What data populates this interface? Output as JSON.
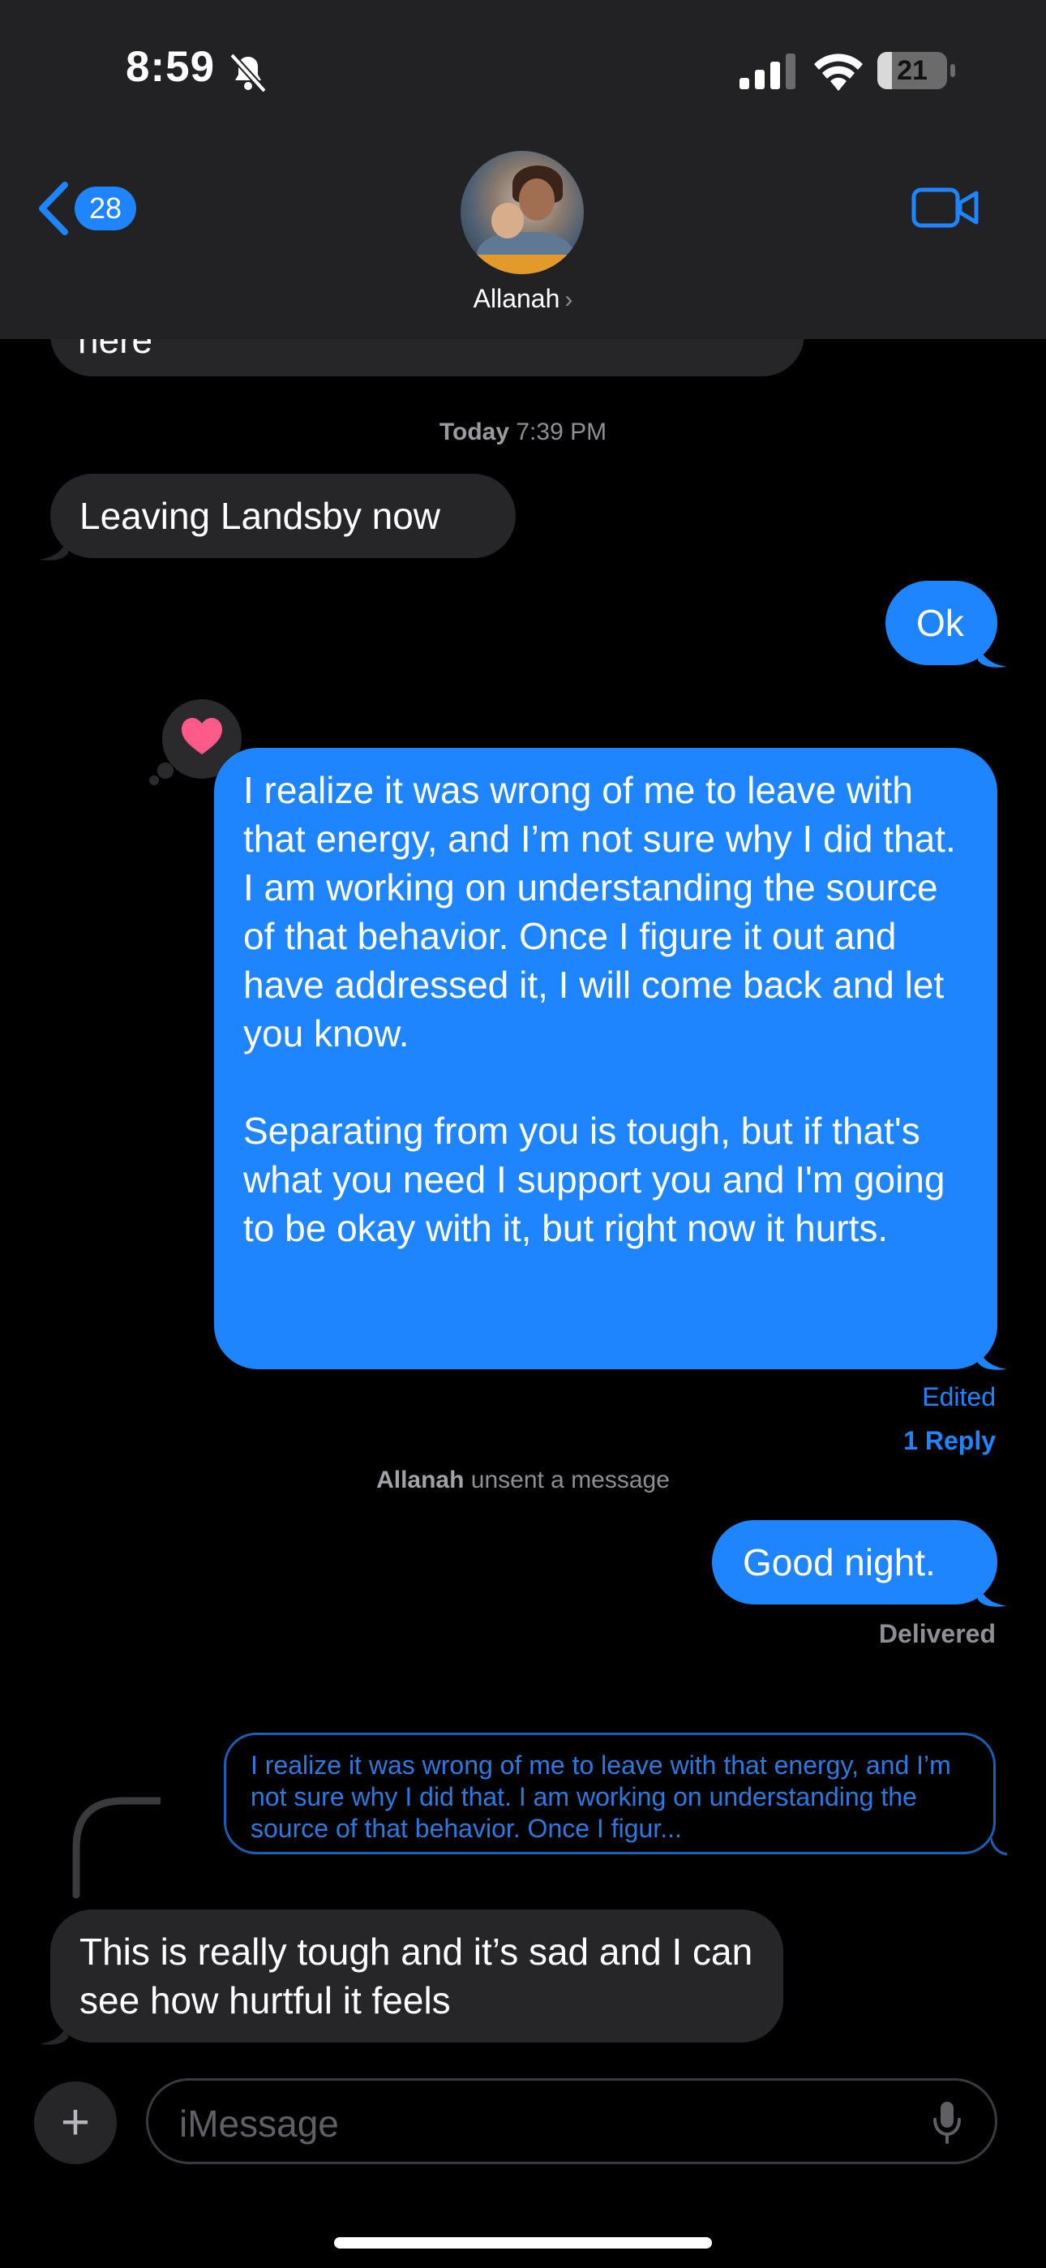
{
  "status_bar": {
    "time": "8:59",
    "battery_level": "21",
    "battery_fraction": 0.21
  },
  "header": {
    "back_count": "28",
    "contact_name": "Allanah",
    "contact_chevron": "›"
  },
  "conversation": {
    "previous_message_fragment": "here",
    "timestamp_day": "Today",
    "timestamp_time": "7:39 PM",
    "messages": [
      {
        "from": "them",
        "text": "Leaving Landsby now"
      },
      {
        "from": "me",
        "text": "Ok"
      },
      {
        "from": "me",
        "reaction": "heart-icon",
        "text_p1": "I realize it was wrong of me to leave with that energy, and I’m not sure why I did that. I am working on understanding the source of that behavior. Once I figure it out and have addressed it, I will come back and let you know.",
        "text_p2": "Separating from you is tough, but if that's what you need I support you and I'm going to be okay with it, but right now it hurts."
      },
      {
        "from": "me",
        "text": "Good night."
      },
      {
        "from": "them",
        "text": "This is really tough and it’s sad and I can see how hurtful it feels"
      }
    ],
    "edited_label": "Edited",
    "reply_label": "1 Reply",
    "unsent_name": "Allanah",
    "unsent_text": "unsent a message",
    "delivered_label": "Delivered",
    "quoted_text": "I realize it was wrong of me to leave with that energy, and I’m not sure why I did that. I am working on understanding the source of that behavior. Once I figur..."
  },
  "input_bar": {
    "plus_label": "+",
    "placeholder": "iMessage"
  },
  "colors": {
    "outgoing": "#1f85ff",
    "incoming": "#262628",
    "heart": "#ff5a8a"
  }
}
